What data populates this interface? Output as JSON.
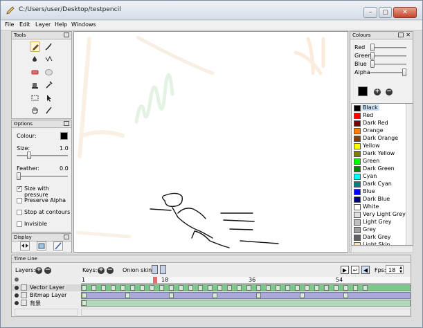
{
  "window": {
    "title": "C:/Users/user/Desktop/testpencil",
    "min": "–",
    "max": "▢",
    "close": "✕"
  },
  "menu": [
    "File",
    "Edit",
    "Layer",
    "Help",
    "Windows"
  ],
  "tools_panel": {
    "title": "Tools"
  },
  "options": {
    "title": "Options",
    "colour_label": "Colour:",
    "size_label": "Size:",
    "size_value": "1.0",
    "feather_label": "Feather:",
    "feather_value": "0.0",
    "checks": [
      {
        "label": "Size with pressure",
        "checked": true
      },
      {
        "label": "Preserve Alpha",
        "checked": false
      },
      {
        "label": "Stop at contours",
        "checked": false
      },
      {
        "label": "Invisible",
        "checked": false
      }
    ]
  },
  "display": {
    "title": "Display"
  },
  "colours": {
    "title": "Colours",
    "sliders": [
      "Red",
      "Green",
      "Blue",
      "Alpha"
    ],
    "list": [
      {
        "name": "Black",
        "color": "#000000"
      },
      {
        "name": "Red",
        "color": "#ff0000"
      },
      {
        "name": "Dark Red",
        "color": "#800000"
      },
      {
        "name": "Orange",
        "color": "#ff8000"
      },
      {
        "name": "Dark Orange",
        "color": "#804000"
      },
      {
        "name": "Yellow",
        "color": "#ffff00"
      },
      {
        "name": "Dark Yellow",
        "color": "#808000"
      },
      {
        "name": "Green",
        "color": "#00ff00"
      },
      {
        "name": "Dark Green",
        "color": "#008000"
      },
      {
        "name": "Cyan",
        "color": "#00ffff"
      },
      {
        "name": "Dark Cyan",
        "color": "#008080"
      },
      {
        "name": "Blue",
        "color": "#0000ff"
      },
      {
        "name": "Dark Blue",
        "color": "#000080"
      },
      {
        "name": "White",
        "color": "#ffffff"
      },
      {
        "name": "Very Light Grey",
        "color": "#e0e0e0"
      },
      {
        "name": "Light Grey",
        "color": "#c0c0c0"
      },
      {
        "name": "Grey",
        "color": "#a0a0a0"
      },
      {
        "name": "Dark Grey",
        "color": "#606060"
      },
      {
        "name": "Light Skin",
        "color": "#ffe4c4"
      }
    ]
  },
  "timeline": {
    "title": "Time Line",
    "layers_label": "Layers:",
    "keys_label": "Keys:",
    "onion_label": "Onion skin:",
    "fps_label": "Fps:",
    "fps_value": "18",
    "ruler": [
      "1",
      "18",
      "36",
      "54"
    ],
    "layers": [
      {
        "name": "Vector Layer",
        "color": "#7ac98a"
      },
      {
        "name": "Bitmap Layer",
        "color": "#a9a9dc"
      },
      {
        "name": "背景",
        "color": "#b3d6bc"
      }
    ]
  }
}
